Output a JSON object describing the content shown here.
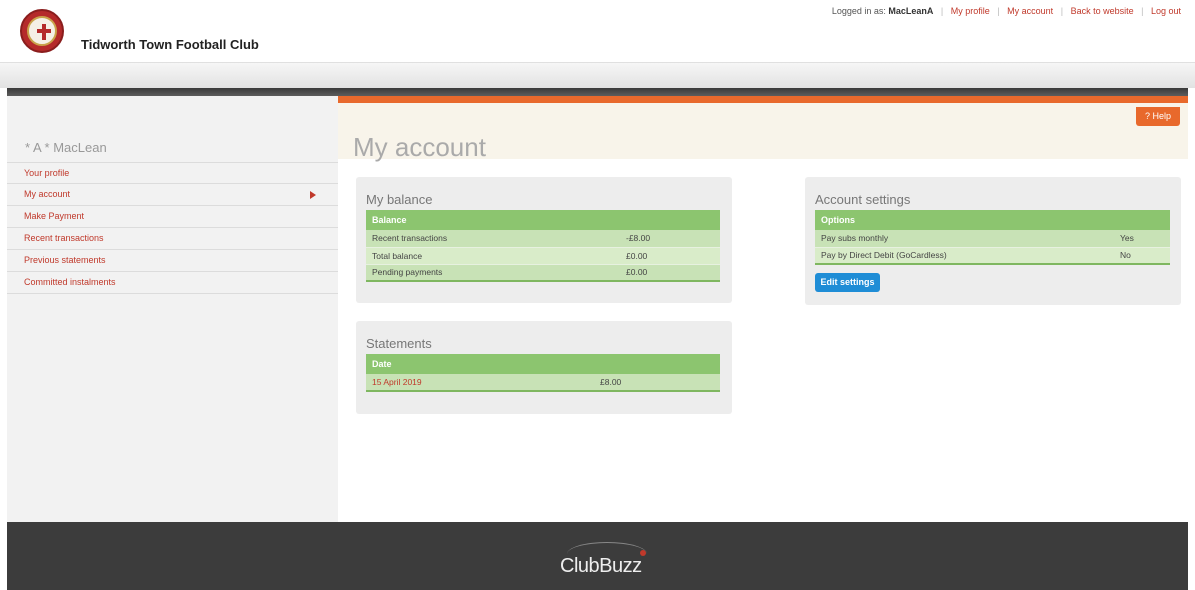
{
  "header": {
    "club_name": "Tidworth Town Football Club",
    "logged_in_label": "Logged in as:",
    "username": "MacLeanA",
    "links": [
      "My profile",
      "My account",
      "Back to website",
      "Log out"
    ]
  },
  "sidebar": {
    "profile_name": "* A * MacLean",
    "items": [
      {
        "label": "Your profile"
      },
      {
        "label": "My account",
        "active": true
      },
      {
        "label": "Make Payment"
      },
      {
        "label": "Recent transactions"
      },
      {
        "label": "Previous statements"
      },
      {
        "label": "Committed instalments"
      }
    ]
  },
  "main": {
    "title": "My account",
    "help_label": "? Help",
    "balance": {
      "title": "My balance",
      "header": "Balance",
      "rows": [
        {
          "label": "Recent transactions",
          "value": "-£8.00"
        },
        {
          "label": "Total balance",
          "value": "£0.00"
        },
        {
          "label": "Pending payments",
          "value": "£0.00"
        }
      ]
    },
    "statements": {
      "title": "Statements",
      "header": "Date",
      "rows": [
        {
          "date": "15 April 2019",
          "amount": "£8.00"
        }
      ]
    },
    "settings": {
      "title": "Account settings",
      "header": "Options",
      "rows": [
        {
          "label": "Pay subs monthly",
          "value": "Yes"
        },
        {
          "label": "Pay by Direct Debit (GoCardless)",
          "value": "No"
        }
      ],
      "edit_label": "Edit settings"
    }
  },
  "footer": {
    "brand": "ClubBuzz"
  },
  "colors": {
    "accent_orange": "#e8692c",
    "link_red": "#c0392b",
    "table_green": "#8cc56f",
    "button_blue": "#1f8dd6"
  }
}
